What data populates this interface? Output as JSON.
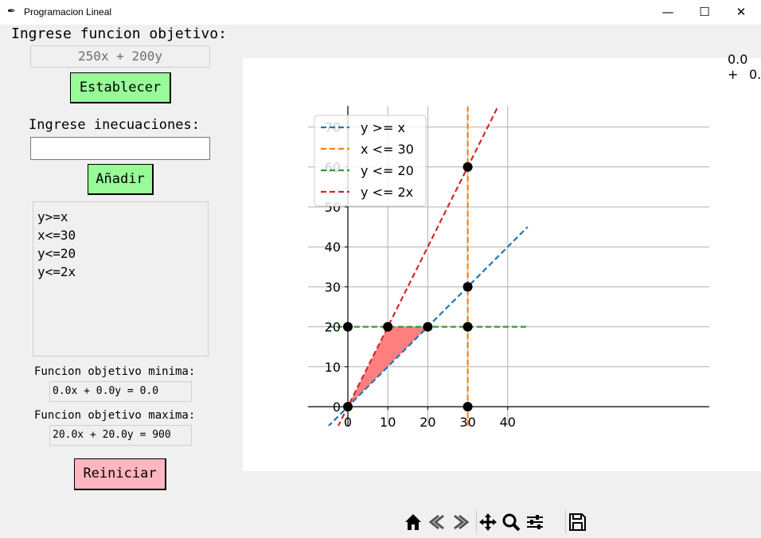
{
  "window": {
    "title": "Programacion Lineal",
    "minimize_glyph": "—",
    "maximize_glyph": "☐",
    "close_glyph": "✕"
  },
  "sidebar": {
    "objective_label": "Ingrese funcion objetivo:",
    "objective_value": "250x + 200y",
    "set_button": "Establecer",
    "inequalities_label": "Ingrese inecuaciones:",
    "inequality_input_value": "",
    "add_button": "Añadir",
    "inequalities": [
      "y>=x",
      "x<=30",
      "y<=20",
      "y<=2x"
    ],
    "min_label": "Funcion objetivo minima:",
    "min_value": "0.0x + 0.0y = 0.0",
    "max_label": "Funcion objetivo maxima:",
    "max_value": "20.0x + 20.0y = 900",
    "reset_button": "Reiniciar"
  },
  "plot": {
    "corner_text_1": "0.0 +",
    "corner_text_2": "0.",
    "colors": {
      "blue": "#1f77b4",
      "orange": "#ff7f0e",
      "green": "#2ca02c",
      "red": "#d62728",
      "feasible": "#ff7f7f"
    }
  },
  "chart_data": {
    "type": "line",
    "xlim": [
      -5,
      45
    ],
    "ylim": [
      -5,
      75
    ],
    "xticks": [
      "0",
      "10",
      "20",
      "30",
      "40"
    ],
    "yticks": [
      "0",
      "10",
      "20",
      "30",
      "40",
      "50",
      "60",
      "70"
    ],
    "grid": true,
    "legend_position": "top-left",
    "series": [
      {
        "name": "y >= x",
        "color": "#1f77b4",
        "style": "dashed",
        "points": [
          [
            -5,
            -5
          ],
          [
            45,
            45
          ]
        ]
      },
      {
        "name": "x <= 30",
        "color": "#ff7f0e",
        "style": "dashed",
        "points": [
          [
            30,
            -5
          ],
          [
            30,
            75
          ]
        ]
      },
      {
        "name": "y <= 20",
        "color": "#2ca02c",
        "style": "dashed",
        "points": [
          [
            -5,
            20
          ],
          [
            45,
            20
          ]
        ]
      },
      {
        "name": "y <= 2x",
        "color": "#d62728",
        "style": "dashed",
        "points": [
          [
            -2.5,
            -5
          ],
          [
            37.5,
            75
          ]
        ]
      }
    ],
    "feasible_region": [
      [
        0,
        0
      ],
      [
        10,
        20
      ],
      [
        20,
        20
      ]
    ],
    "intersection_points": [
      [
        0,
        0
      ],
      [
        0,
        20
      ],
      [
        10,
        20
      ],
      [
        20,
        20
      ],
      [
        30,
        0
      ],
      [
        30,
        20
      ],
      [
        30,
        30
      ],
      [
        30,
        60
      ]
    ]
  },
  "toolbar": {
    "buttons": [
      "home-icon",
      "back-icon",
      "forward-icon",
      "pan-icon",
      "zoom-icon",
      "configure-icon",
      "save-icon"
    ]
  }
}
